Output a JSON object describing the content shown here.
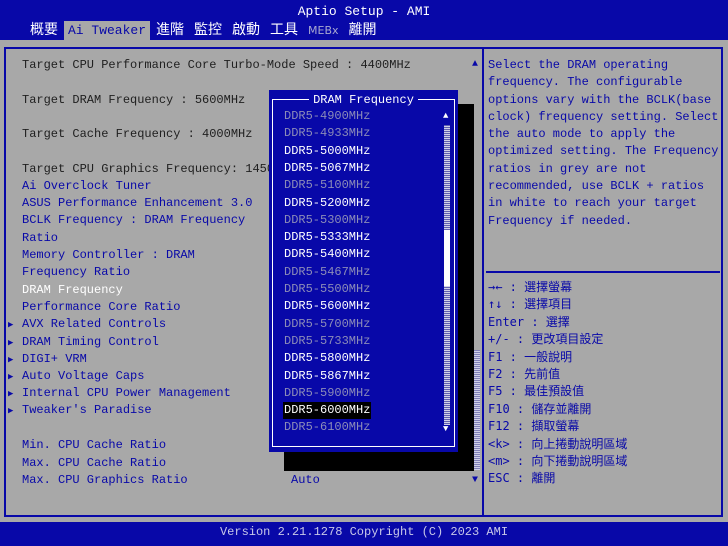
{
  "header": {
    "title": "Aptio Setup - AMI",
    "tabs": [
      {
        "label": "概要"
      },
      {
        "label": "Ai Tweaker",
        "active": true
      },
      {
        "label": "進階"
      },
      {
        "label": "監控"
      },
      {
        "label": "啟動"
      },
      {
        "label": "工具"
      },
      {
        "label": "MEBx",
        "dim": true
      },
      {
        "label": "離開"
      }
    ]
  },
  "settings": [
    {
      "label": "Target CPU Performance Core Turbo-Mode Speed : 4400MHz",
      "type": "info"
    },
    {
      "label": "Target DRAM Frequency : 5600MHz",
      "type": "info"
    },
    {
      "label": "Target Cache Frequency : 4000MHz",
      "type": "info"
    },
    {
      "label": "Target CPU Graphics Frequency: 1450MHz",
      "type": "info"
    },
    {
      "label": "Ai Overclock Tuner",
      "type": "link"
    },
    {
      "label": "ASUS Performance Enhancement 3.0",
      "type": "link"
    },
    {
      "label": "BCLK Frequency : DRAM Frequency",
      "type": "link"
    },
    {
      "label": "Ratio",
      "type": "link"
    },
    {
      "label": "Memory Controller : DRAM",
      "type": "link"
    },
    {
      "label": "Frequency Ratio",
      "type": "link"
    },
    {
      "label": "DRAM Frequency",
      "type": "sel"
    },
    {
      "label": "Performance Core Ratio",
      "type": "link"
    },
    {
      "label": "AVX Related Controls",
      "type": "link",
      "submenu": true
    },
    {
      "label": "DRAM Timing Control",
      "type": "link",
      "submenu": true
    },
    {
      "label": "DIGI+ VRM",
      "type": "link",
      "submenu": true
    },
    {
      "label": "Auto Voltage Caps",
      "type": "link",
      "submenu": true
    },
    {
      "label": "Internal CPU Power Management",
      "type": "link",
      "submenu": true
    },
    {
      "label": "Tweaker's Paradise",
      "type": "link",
      "submenu": true
    },
    {
      "label": "Min. CPU Cache Ratio",
      "type": "link"
    },
    {
      "label": "Max. CPU Cache Ratio",
      "type": "link"
    },
    {
      "label": "Max. CPU Graphics Ratio",
      "type": "link",
      "value": "Auto"
    }
  ],
  "popup": {
    "title": "DRAM Frequency",
    "options": [
      {
        "label": "DDR5-4900MHz",
        "grey": true
      },
      {
        "label": "DDR5-4933MHz",
        "grey": true
      },
      {
        "label": "DDR5-5000MHz"
      },
      {
        "label": "DDR5-5067MHz"
      },
      {
        "label": "DDR5-5100MHz",
        "grey": true
      },
      {
        "label": "DDR5-5200MHz"
      },
      {
        "label": "DDR5-5300MHz",
        "grey": true
      },
      {
        "label": "DDR5-5333MHz"
      },
      {
        "label": "DDR5-5400MHz"
      },
      {
        "label": "DDR5-5467MHz",
        "grey": true
      },
      {
        "label": "DDR5-5500MHz",
        "grey": true
      },
      {
        "label": "DDR5-5600MHz"
      },
      {
        "label": "DDR5-5700MHz",
        "grey": true
      },
      {
        "label": "DDR5-5733MHz",
        "grey": true
      },
      {
        "label": "DDR5-5800MHz"
      },
      {
        "label": "DDR5-5867MHz"
      },
      {
        "label": "DDR5-5900MHz",
        "grey": true
      },
      {
        "label": "DDR5-6000MHz",
        "highlighted": true
      },
      {
        "label": "DDR5-6100MHz",
        "grey": true
      }
    ]
  },
  "help": {
    "text": "Select the DRAM operating frequency. The configurable options vary with the BCLK(base clock) frequency setting. Select the auto mode to apply the optimized setting. The Frequency ratios in grey are not recommended, use BCLK + ratios in white to reach your target Frequency if needed.",
    "keys": [
      "→← : 選擇螢幕",
      "↑↓ : 選擇項目",
      "Enter : 選擇",
      "+/- : 更改項目設定",
      "F1 : 一般說明",
      "F2 : 先前值",
      "F5 : 最佳預設值",
      "F10 : 儲存並離開",
      "F12 : 擷取螢幕",
      "<k> : 向上捲動說明區域",
      "<m> : 向下捲動說明區域",
      "ESC : 離開"
    ]
  },
  "footer": {
    "text": "Version 2.21.1278 Copyright (C) 2023 AMI"
  }
}
